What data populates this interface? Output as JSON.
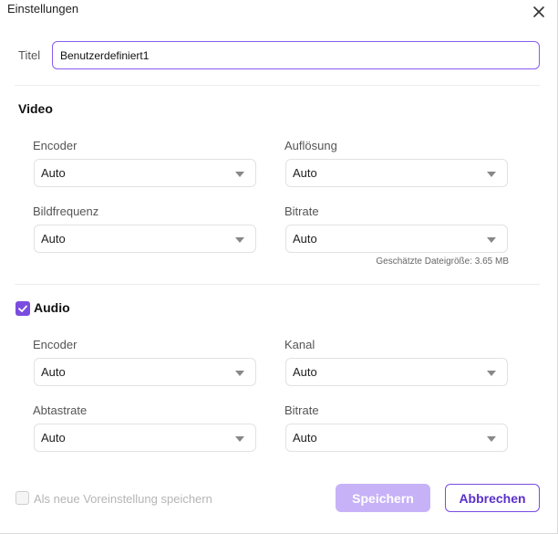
{
  "window": {
    "title": "Einstellungen",
    "close_icon": "close-icon"
  },
  "titel": {
    "label": "Titel",
    "value": "Benutzerdefiniert1"
  },
  "video": {
    "heading": "Video",
    "encoder": {
      "label": "Encoder",
      "value": "Auto"
    },
    "aufloesung": {
      "label": "Auflösung",
      "value": "Auto"
    },
    "bildfrequenz": {
      "label": "Bildfrequenz",
      "value": "Auto"
    },
    "bitrate": {
      "label": "Bitrate",
      "value": "Auto"
    },
    "estimate": "Geschätzte Dateigröße: 3.65 MB"
  },
  "audio": {
    "heading": "Audio",
    "enabled": true,
    "encoder": {
      "label": "Encoder",
      "value": "Auto"
    },
    "kanal": {
      "label": "Kanal",
      "value": "Auto"
    },
    "abtastrate": {
      "label": "Abtastrate",
      "value": "Auto"
    },
    "bitrate": {
      "label": "Bitrate",
      "value": "Auto"
    }
  },
  "footer": {
    "preset_label": "Als neue Voreinstellung speichern",
    "preset_checked": false,
    "save_label": "Speichern",
    "cancel_label": "Abbrechen"
  },
  "colors": {
    "accent": "#7b4ce0",
    "save_button_disabled": "#c7b2f7",
    "input_border": "#8a5cf0"
  }
}
